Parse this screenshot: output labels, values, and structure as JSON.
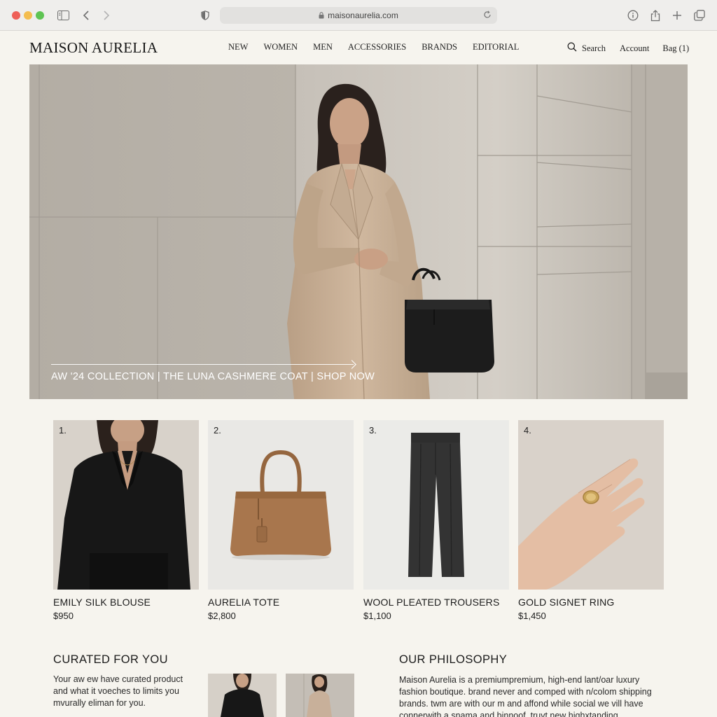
{
  "browser": {
    "url": "maisonaurelia.com"
  },
  "site": {
    "logo": "MAISON AURELIA",
    "nav": [
      "NEW",
      "WOMEN",
      "MEN",
      "ACCESSORIES",
      "BRANDS",
      "EDITORIAL"
    ],
    "search_label": "Search",
    "account_label": "Account",
    "bag_label": "Bag (1)"
  },
  "hero": {
    "cta": "AW '24 COLLECTION | THE LUNA CASHMERE COAT | SHOP NOW"
  },
  "products": [
    {
      "num": "1.",
      "name": "EMILY SILK BLOUSE",
      "price": "$950"
    },
    {
      "num": "2.",
      "name": "AURELIA TOTE",
      "price": "$2,800"
    },
    {
      "num": "3.",
      "name": "WOOL PLEATED TROUSERS",
      "price": "$1,100"
    },
    {
      "num": "4.",
      "name": "GOLD SIGNET RING",
      "price": "$1,450"
    }
  ],
  "curated": {
    "title": "CURATED FOR YOU",
    "lines": [
      "Your aw ew have curated product",
      "and what it voeches to limits you",
      "mvurally eliman for you."
    ]
  },
  "philosophy": {
    "title": "OUR PHILOSOPHY",
    "lines": [
      "Maison Aurelia is a premiumpremium, high-end lant/oar luxury",
      "fashion boutique. brand never and comped with n/colom shipping",
      "brands. twm are with our m and affond while social we vill have",
      "connerwith a snama and binnoof. truvt new highxtanding."
    ]
  },
  "colors": {
    "page_bg": "#f6f4ee",
    "chrome_bg": "#efeeec",
    "text": "#1c1c1c",
    "coat": "#c9b29a",
    "tote": "#a8764d"
  }
}
